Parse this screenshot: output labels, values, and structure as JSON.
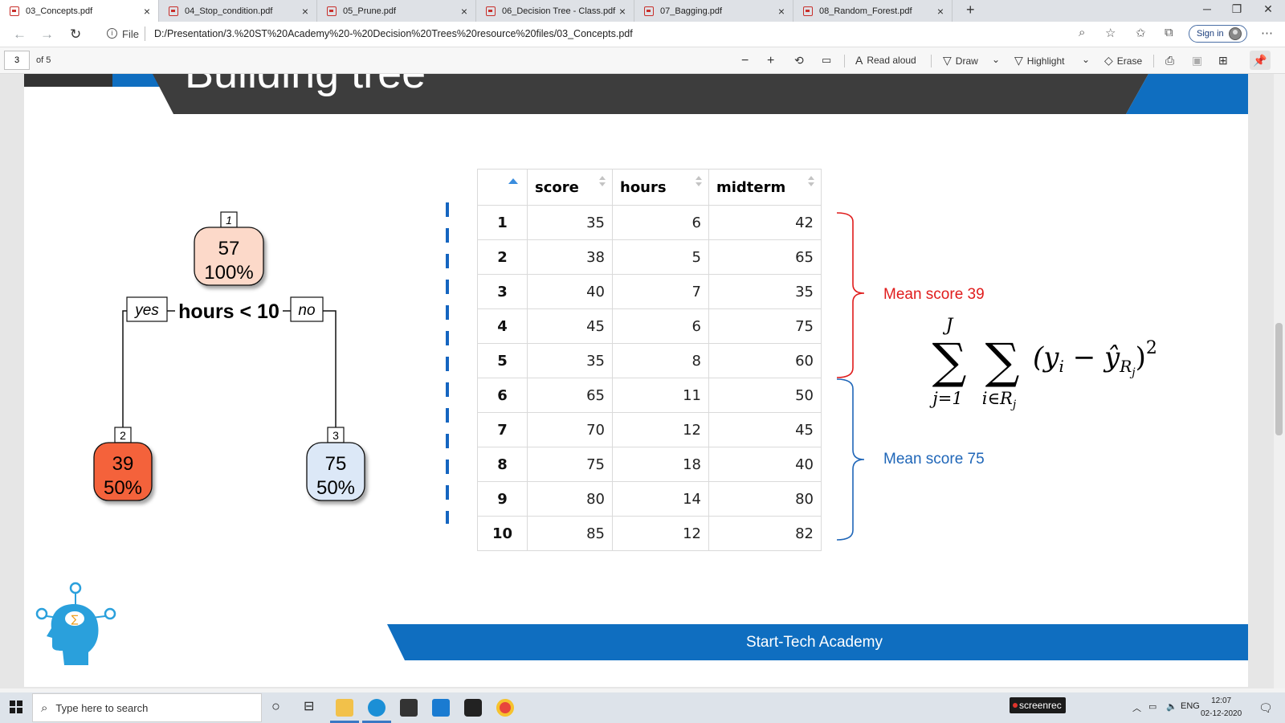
{
  "browser": {
    "tabs": [
      {
        "title": "03_Concepts.pdf",
        "active": true
      },
      {
        "title": "04_Stop_condition.pdf",
        "active": false
      },
      {
        "title": "05_Prune.pdf",
        "active": false
      },
      {
        "title": "06_Decision Tree - Class.pdf",
        "active": false
      },
      {
        "title": "07_Bagging.pdf",
        "active": false
      },
      {
        "title": "08_Random_Forest.pdf",
        "active": false
      }
    ],
    "close_glyph": "×",
    "new_tab_glyph": "+",
    "address": {
      "scheme_label": "File",
      "url": "D:/Presentation/3.%20ST%20Academy%20-%20Decision%20Trees%20resource%20files/03_Concepts.pdf"
    },
    "sign_in_label": "Sign in"
  },
  "pdf_toolbar": {
    "page_number": "3",
    "page_of": "of 5",
    "read_aloud": "Read aloud",
    "draw": "Draw",
    "highlight": "Highlight",
    "erase": "Erase"
  },
  "slide": {
    "title": "Building tree",
    "tree": {
      "root": {
        "id": "1",
        "value": "57",
        "percent": "100%"
      },
      "split_rule": "hours < 10",
      "yes_label": "yes",
      "no_label": "no",
      "left": {
        "id": "2",
        "value": "39",
        "percent": "50%"
      },
      "right": {
        "id": "3",
        "value": "75",
        "percent": "50%"
      }
    },
    "table": {
      "headers": [
        "",
        "score",
        "hours",
        "midterm"
      ],
      "rows": [
        [
          "1",
          "35",
          "6",
          "42"
        ],
        [
          "2",
          "38",
          "5",
          "65"
        ],
        [
          "3",
          "40",
          "7",
          "35"
        ],
        [
          "4",
          "45",
          "6",
          "75"
        ],
        [
          "5",
          "35",
          "8",
          "60"
        ],
        [
          "6",
          "65",
          "11",
          "50"
        ],
        [
          "7",
          "70",
          "12",
          "45"
        ],
        [
          "8",
          "75",
          "18",
          "40"
        ],
        [
          "9",
          "80",
          "14",
          "80"
        ],
        [
          "10",
          "85",
          "12",
          "82"
        ]
      ]
    },
    "mean_red_label": "Mean score 39",
    "mean_blue_label": "Mean score 75",
    "formula": {
      "sum1_upper": "J",
      "sum1_lower": "j=1",
      "sum2_lower": "i∈R",
      "sum2_lower_sub": "j",
      "body": "(y",
      "sub_i": "i",
      "minus": " − ",
      "yhat": "ŷ",
      "sub_r": "R",
      "sub_j": "j",
      "close": ")",
      "power": "2"
    },
    "footer": "Start-Tech Academy",
    "colors": {
      "red": "#e01c1c",
      "blue": "#1f66b8",
      "node_red": "#f4623a",
      "node_peach": "#fcd9c9",
      "node_blue": "#dce8f7"
    }
  },
  "taskbar": {
    "search_placeholder": "Type here to search",
    "recorder_label": "screenrec",
    "tray_lang": "ENG",
    "time": "12:07",
    "date": "02-12-2020"
  }
}
